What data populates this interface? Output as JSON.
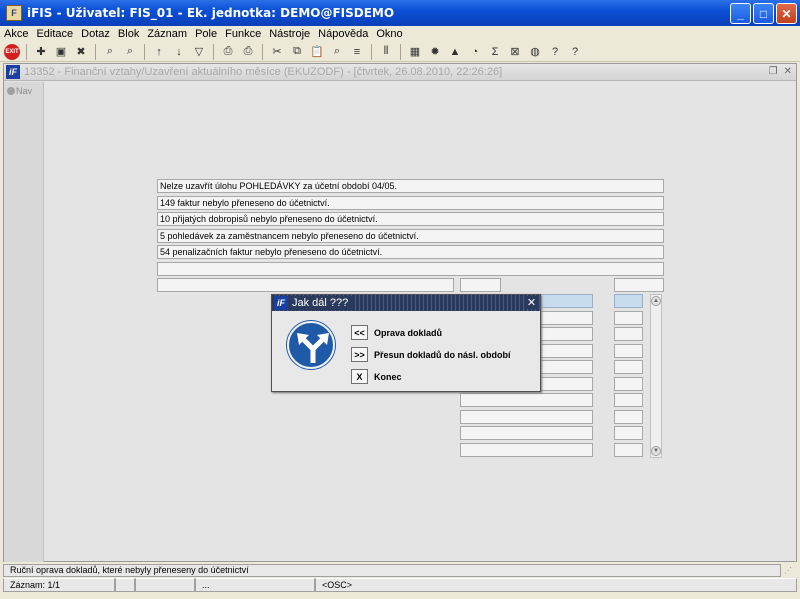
{
  "titlebar": {
    "icon_text": "F",
    "title": "iFIS - Uživatel: FIS_01 - Ek. jednotka: DEMO@FISDEMO",
    "minimize": "_",
    "maximize": "□",
    "close": "✕"
  },
  "menu": [
    "Akce",
    "Editace",
    "Dotaz",
    "Blok",
    "Záznam",
    "Pole",
    "Funkce",
    "Nástroje",
    "Nápověda",
    "Okno"
  ],
  "toolbar": {
    "exit_label": "EXIT"
  },
  "inner_window": {
    "icon_text": "iF",
    "title": "13352 - Finanční vztahy/Uzavření aktuálního měsíce (EKUZODF) - [čtvrtek, 26.08.2010, 22:26:26]",
    "nav_label": "Nav"
  },
  "messages": [
    "Nelze uzavřít úlohu POHLEDÁVKY za účetní období 04/05.",
    "149 faktur nebylo přeneseno do účetnictví.",
    "10 přijatých dobropisů nebylo přeneseno do účetnictví.",
    "5 pohledávek za zaměstnancem nebylo přeneseno do účetnictví.",
    "54 penalizačních faktur nebylo přeneseno do účetnictví.",
    ""
  ],
  "dialog": {
    "icon_text": "iF",
    "title": "Jak dál ???",
    "close": "✕",
    "options": [
      {
        "button": "<<",
        "label": "Oprava dokladů"
      },
      {
        "button": ">>",
        "label": "Přesun dokladů do násl. období"
      },
      {
        "button": "X",
        "label": "Konec"
      }
    ]
  },
  "status": {
    "hint": "Ruční oprava dokladů, které nebyly přeneseny do účetnictví",
    "record": "Záznam: 1/1",
    "cell3": "...",
    "osc": "<OSC>"
  },
  "colors": {
    "titlebar": "#0b4fd6",
    "dialog_title": "#2a3a5c",
    "sign": "#1e5aa8",
    "highlight_field": "#c8dcf0"
  }
}
